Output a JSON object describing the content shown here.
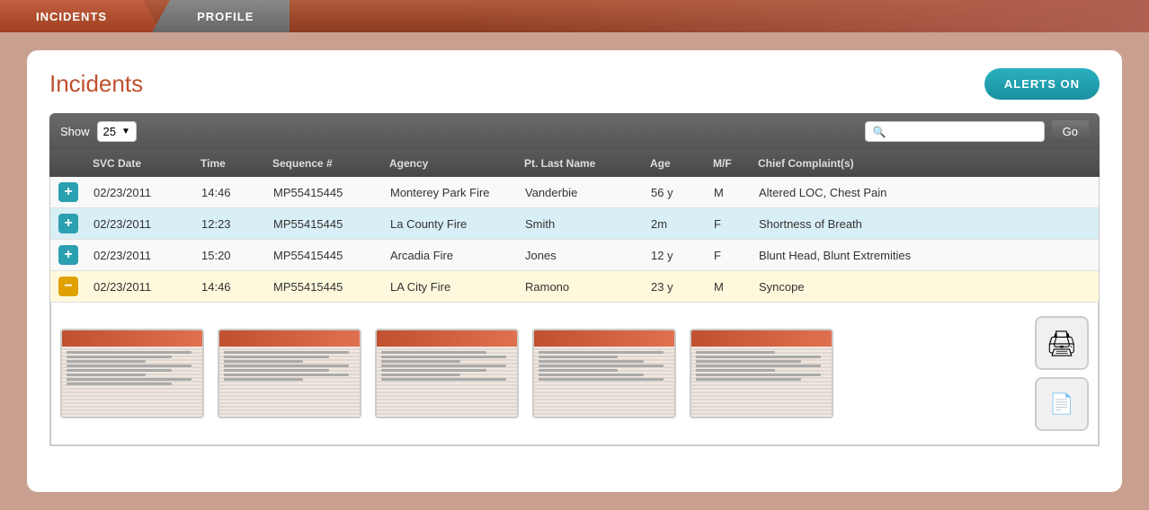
{
  "nav": {
    "tabs": [
      {
        "label": "INCIDENTS",
        "active": true
      },
      {
        "label": "PROFILE",
        "active": false
      }
    ]
  },
  "header": {
    "title": "Incidents",
    "alerts_button": "ALERTS ON"
  },
  "controls": {
    "show_label": "Show",
    "show_value": "25",
    "go_button": "Go",
    "search_placeholder": ""
  },
  "table": {
    "columns": [
      "",
      "SVC Date",
      "Time",
      "Sequence #",
      "Agency",
      "Pt. Last Name",
      "Age",
      "M/F",
      "Chief Complaint(s)"
    ],
    "rows": [
      {
        "btn_type": "plus",
        "svc_date": "02/23/2011",
        "time": "14:46",
        "sequence": "MP55415445",
        "agency": "Monterey Park Fire",
        "last_name": "Vanderbie",
        "age": "56 y",
        "mf": "M",
        "complaint": "Altered LOC, Chest Pain",
        "highlighted": false
      },
      {
        "btn_type": "plus",
        "svc_date": "02/23/2011",
        "time": "12:23",
        "sequence": "MP55415445",
        "agency": "La County Fire",
        "last_name": "Smith",
        "age": "2m",
        "mf": "F",
        "complaint": "Shortness of Breath",
        "highlighted": false
      },
      {
        "btn_type": "plus",
        "svc_date": "02/23/2011",
        "time": "15:20",
        "sequence": "MP55415445",
        "agency": "Arcadia Fire",
        "last_name": "Jones",
        "age": "12 y",
        "mf": "F",
        "complaint": "Blunt Head, Blunt Extremities",
        "highlighted": false
      },
      {
        "btn_type": "minus",
        "svc_date": "02/23/2011",
        "time": "14:46",
        "sequence": "MP55415445",
        "agency": "LA City Fire",
        "last_name": "Ramono",
        "age": "23 y",
        "mf": "M",
        "complaint": "Syncope",
        "highlighted": true
      }
    ]
  },
  "docs": {
    "count": 5
  },
  "icons": {
    "search": "🔍",
    "printer": "🖨",
    "expand": "+",
    "collapse": "-",
    "dropdown": "▼"
  }
}
